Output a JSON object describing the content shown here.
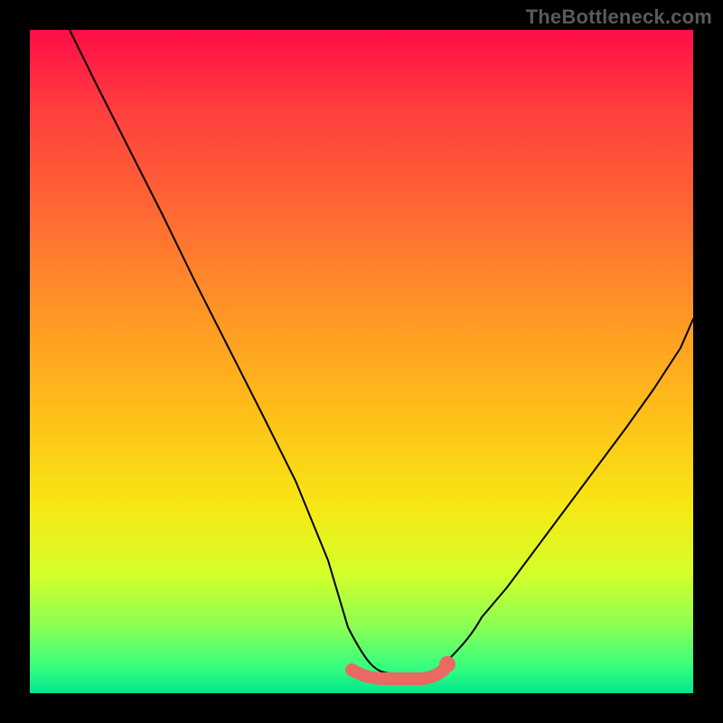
{
  "watermark": "TheBottleneck.com",
  "chart_data": {
    "type": "line",
    "title": "",
    "xlabel": "",
    "ylabel": "",
    "xlim": [
      0,
      100
    ],
    "ylim": [
      0,
      100
    ],
    "series": [
      {
        "name": "bottleneck-curve",
        "x": [
          6,
          10,
          15,
          20,
          25,
          30,
          35,
          40,
          45,
          48,
          52,
          56,
          60,
          62,
          66,
          72,
          78,
          85,
          92,
          100
        ],
        "y": [
          100,
          92,
          82,
          72,
          62,
          52,
          42,
          32,
          20,
          10,
          3,
          3,
          3,
          4,
          8,
          16,
          26,
          36,
          46,
          58
        ]
      }
    ],
    "annotations": [
      {
        "name": "min-plateau",
        "x_range": [
          48,
          62
        ],
        "y": 3
      }
    ],
    "background_gradient": {
      "direction": "vertical",
      "stops": [
        {
          "pos": 0.0,
          "color": "#ff0d48"
        },
        {
          "pos": 0.5,
          "color": "#ffbf19"
        },
        {
          "pos": 0.85,
          "color": "#d4ff2a"
        },
        {
          "pos": 1.0,
          "color": "#00e68e"
        }
      ]
    }
  }
}
